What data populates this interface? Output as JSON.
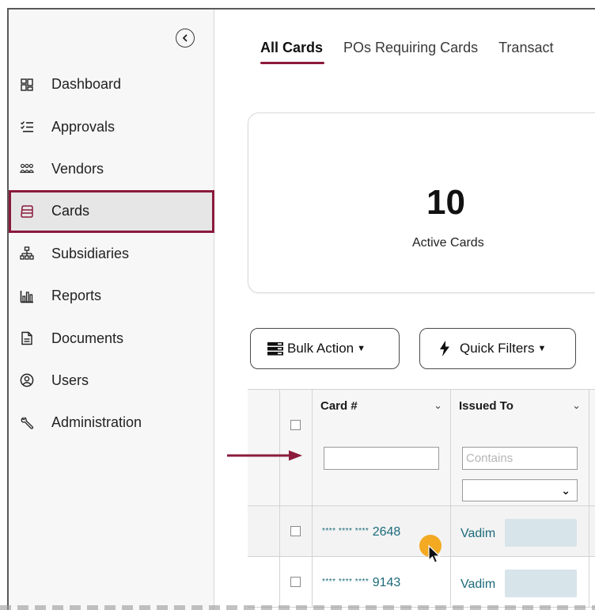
{
  "sidebar": {
    "items": [
      {
        "label": "Dashboard",
        "icon": "grid-icon"
      },
      {
        "label": "Approvals",
        "icon": "checklist-icon"
      },
      {
        "label": "Vendors",
        "icon": "people-icon"
      },
      {
        "label": "Cards",
        "icon": "card-icon",
        "active": true
      },
      {
        "label": "Subsidiaries",
        "icon": "org-chart-icon"
      },
      {
        "label": "Reports",
        "icon": "bar-chart-icon"
      },
      {
        "label": "Documents",
        "icon": "document-icon"
      },
      {
        "label": "Users",
        "icon": "user-icon"
      },
      {
        "label": "Administration",
        "icon": "wrench-icon"
      }
    ]
  },
  "tabs": [
    {
      "label": "All Cards",
      "active": true
    },
    {
      "label": "POs Requiring Cards"
    },
    {
      "label": "Transact"
    }
  ],
  "stat": {
    "value": "10",
    "label": "Active Cards"
  },
  "toolbar": {
    "bulk_label": "Bulk Action",
    "quick_label": "Quick Filters"
  },
  "table": {
    "columns": [
      "Card #",
      "Issued To"
    ],
    "filter_placeholder": "Contains",
    "rows": [
      {
        "mask": "**** **** ****",
        "last4": "2648",
        "issued_to": "Vadim"
      },
      {
        "mask": "**** **** ****",
        "last4": "9143",
        "issued_to": "Vadim"
      }
    ]
  },
  "colors": {
    "accent": "#8b1a3b",
    "link": "#1c6b7a",
    "cursor_highlight": "#f2a516"
  }
}
